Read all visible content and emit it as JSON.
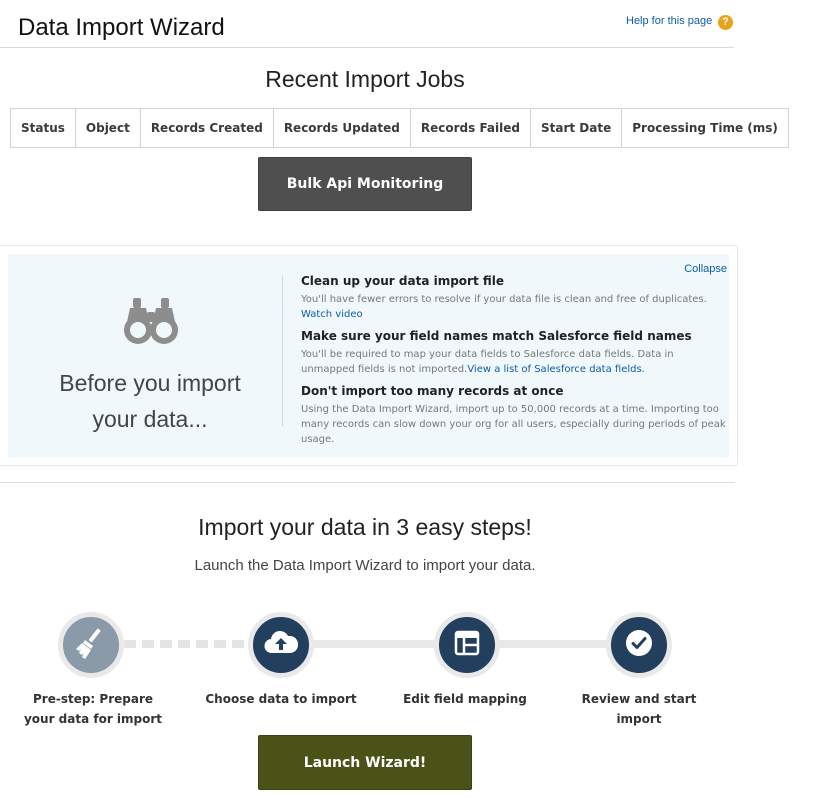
{
  "header": {
    "title": "Data Import Wizard",
    "help_link": "Help for this page",
    "help_icon": "?"
  },
  "recent_jobs": {
    "title": "Recent Import Jobs",
    "columns": [
      "Status",
      "Object",
      "Records Created",
      "Records Updated",
      "Records Failed",
      "Start Date",
      "Processing Time (ms)"
    ],
    "bulk_button": "Bulk Api Monitoring"
  },
  "tips": {
    "collapse": "Collapse",
    "icon": "binoculars-icon",
    "before_text": "Before you import your data...",
    "items": [
      {
        "heading": "Clean up your data import file",
        "body": "You'll have fewer errors to resolve if your data file is clean and free of duplicates. ",
        "link": "Watch video"
      },
      {
        "heading": "Make sure your field names match Salesforce field names",
        "body": "You'll be required to map your data fields to Salesforce data fields. Data in unmapped fields is not imported.",
        "link": "View a list of Salesforce data fields."
      },
      {
        "heading": "Don't import too many records at once",
        "body": "Using the Data Import Wizard, import up to 50,000 records at a time. Importing too many records can slow down your org for all users, especially during periods of peak usage.",
        "link": ""
      }
    ]
  },
  "steps": {
    "title": "Import your data in 3 easy steps!",
    "subtitle": "Launch the Data Import Wizard to import your data.",
    "items": [
      {
        "label": "Pre-step: Prepare your data for import",
        "icon": "broom-icon"
      },
      {
        "label": "Choose data to import",
        "icon": "cloud-upload-icon"
      },
      {
        "label": "Edit field mapping",
        "icon": "layout-icon"
      },
      {
        "label": "Review and start import",
        "icon": "checkmark-icon"
      }
    ],
    "launch_button": "Launch Wizard!"
  },
  "colors": {
    "link": "#0b5cab",
    "help_icon": "#e8a317",
    "bulk_button": "#4f4f4f",
    "launch_button": "#4a5217",
    "step_navy": "#223f5e",
    "step_gray": "#8a9aa8",
    "tips_bg": "#f1f8fb"
  }
}
